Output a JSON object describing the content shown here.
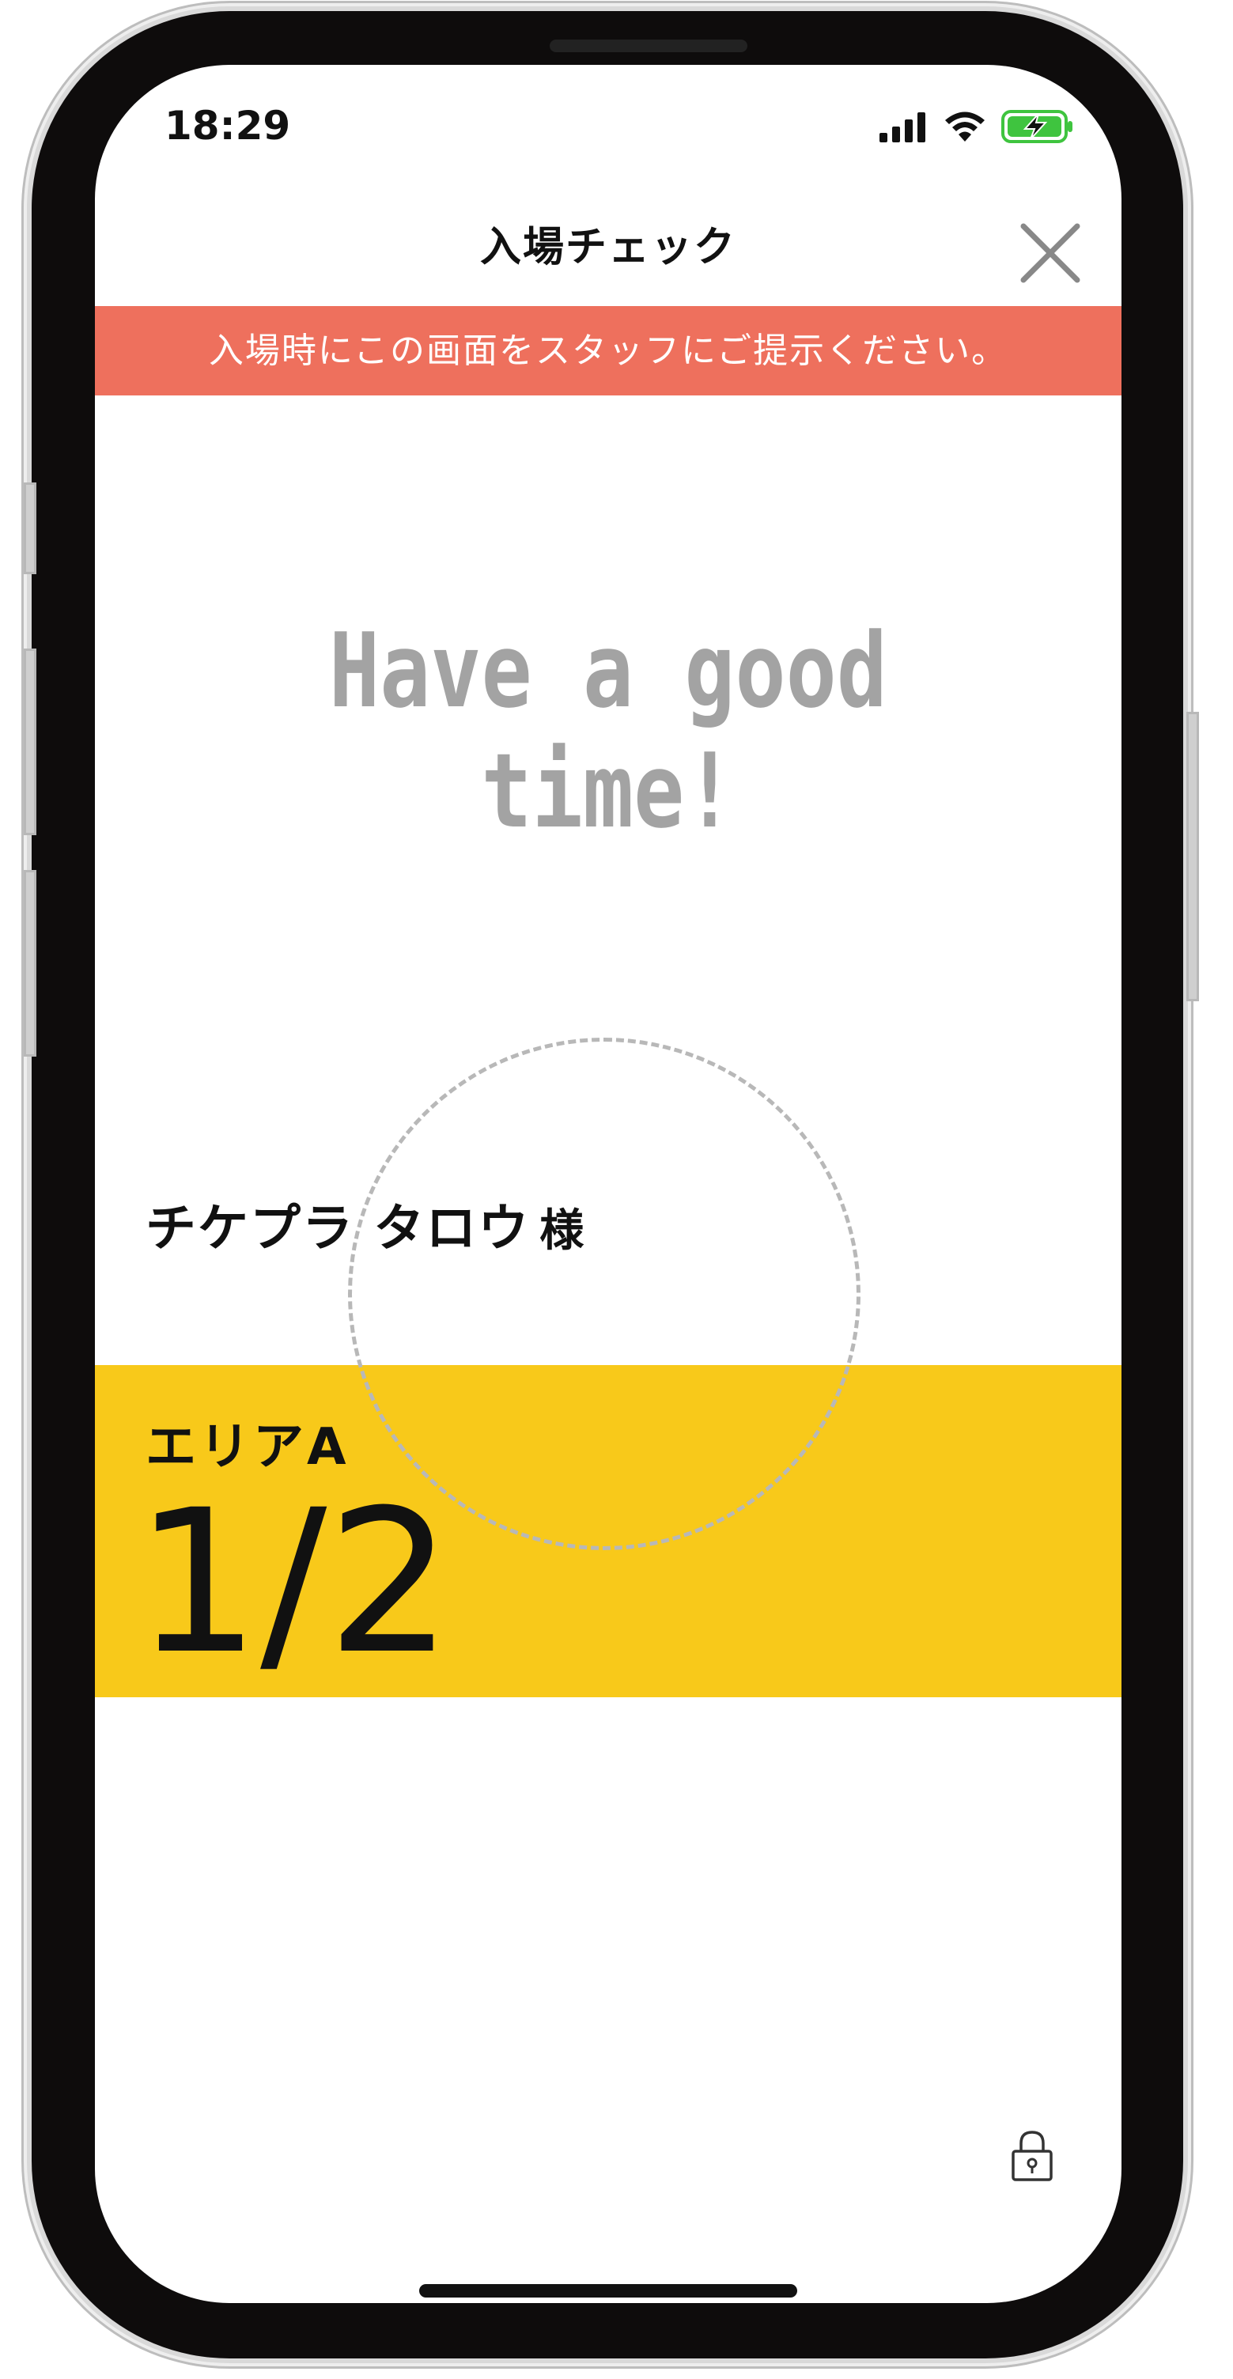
{
  "status_bar": {
    "time": "18:29"
  },
  "nav": {
    "title": "入場チェック"
  },
  "banner": {
    "text": "入場時にこの画面をスタッフにご提示ください。"
  },
  "greeting": "Have a good time!",
  "holder": {
    "name": "チケプラ タロウ",
    "honorific": "様"
  },
  "ticket": {
    "area": "エリアA",
    "count": "1/2"
  },
  "colors": {
    "banner": "#ee705d",
    "area_band": "#f8c91a",
    "greeting_text": "#a3a3a3",
    "battery": "#3fc43f"
  },
  "icons": [
    "signal-icon",
    "wifi-icon",
    "battery-charging-icon",
    "close-icon",
    "lock-icon"
  ]
}
